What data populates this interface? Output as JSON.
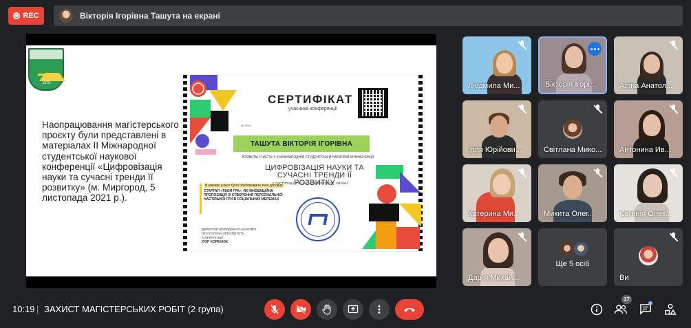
{
  "top": {
    "rec_label": "REC",
    "presenting_text": "Вікторія Ігорівна Ташута на екрані"
  },
  "slide": {
    "crest_year": "1979",
    "body_text": "Наопрацювання магістерського проєкту були представлені в матеріалах ІІ Міжнародної студентської наукової конференції «Цифровізація науки та сучасні тренди її розвитку» (м. Миргород, 5 листопада 2021 р.).",
    "certificate": {
      "title": "СЕРТИФІКАТ",
      "subtitle": "учасника конференції",
      "number": "№ 3003",
      "recipient": "ТАШУТА ВІКТОРІЯ ІГОРІВНА",
      "participation": "ВЗЯВ(ЛА) УЧАСТЬ У ІІ МІЖНАРОДНІЙ СТУДЕНТСЬКІЙ НАУКОВІЙ КОНФЕРЕНЦІЇ",
      "topic": "ЦИФРОВІЗАЦІЯ НАУКИ ТА СУЧАСНІ ТРЕНДИ ЇЇ РОЗВИТКУ",
      "date_place": "5 ЛИСТОПАДА 2021 РІК — М. МИРГОРОД, УКРАЇНА",
      "report_heading": "В рамках участі було опубліковано тези доповіді",
      "report_title": "СТАРТАП «ТВОЯ ГРА». ЯК ІННОВАЦІЙНА ПРОПОЗИЦІЯ ЗІ СТВОРЕННЯ ПЕРСОНАЛЬНОЇ НАСТІЛЬНОЇ ГРИ В СОЦІАЛЬНИХ МЕРЕЖАХ",
      "director_role": "ДИРЕКТОР МОЛОДІЖНОЇ НАУКОВОЇ ЛІГИ ГОЛОВА ОРГКОМІТЕТУ КОНФЕРЕНЦІЇ",
      "director_name": "ІГОР КОРЕНЮК"
    }
  },
  "participants": [
    {
      "name": "Людмила Ми...",
      "muted": true
    },
    {
      "name": "Вікторія Ігорі...",
      "muted": false
    },
    {
      "name": "Аліна Анатол...",
      "muted": true
    },
    {
      "name": "Ілля Юрійови...",
      "muted": true
    },
    {
      "name": "Світлана Мико...",
      "muted": true
    },
    {
      "name": "Антонина Ив...",
      "muted": true
    },
    {
      "name": "Катерина Ми...",
      "muted": true
    },
    {
      "name": "Микита Олег...",
      "muted": true
    },
    {
      "name": "Євгенія Олек...",
      "muted": true
    },
    {
      "name": "Дар`я Михай...",
      "muted": true
    },
    {
      "name": "Ще 5 осіб",
      "muted": false
    },
    {
      "name": "Ви",
      "muted": true
    }
  ],
  "bottom": {
    "time": "10:19",
    "separator": "|",
    "meeting_title": "ЗАХИСТ МАГІСТЕРСЬКИХ РОБІТ (2 група)",
    "participant_count": "17"
  },
  "colors": {
    "background": "#202124",
    "tile": "#3c4043",
    "danger": "#ea4335",
    "accent": "#1a73e8",
    "cert_green": "#9bd35a"
  },
  "icons": [
    "record-icon",
    "mic-off-icon",
    "camera-off-icon",
    "raise-hand-icon",
    "present-icon",
    "more-vert-icon",
    "end-call-icon",
    "info-icon",
    "people-icon",
    "chat-icon",
    "activities-icon"
  ]
}
